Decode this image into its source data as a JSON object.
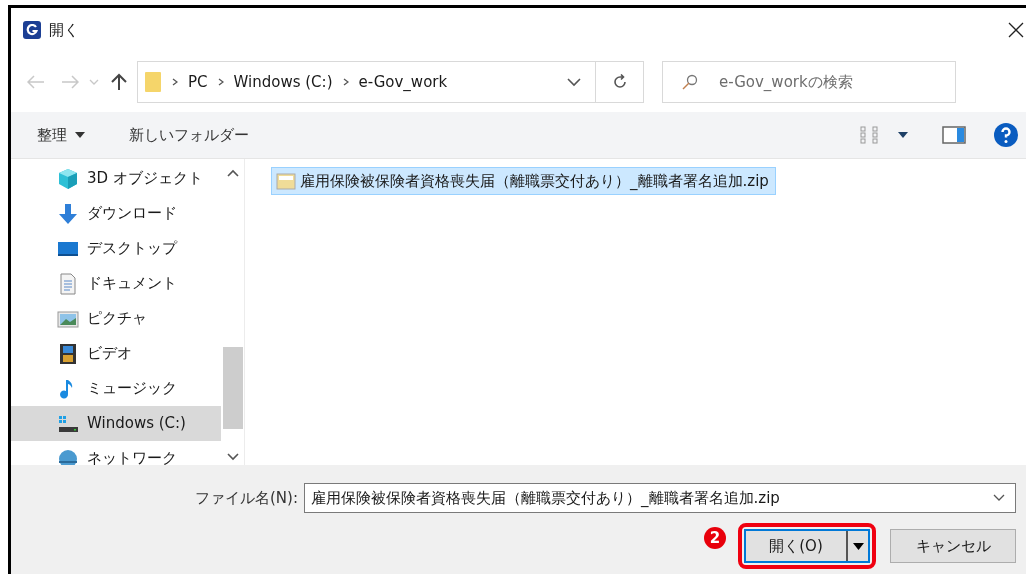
{
  "window": {
    "title": "開く"
  },
  "address": {
    "path": [
      "PC",
      "Windows (C:)",
      "e-Gov_work"
    ]
  },
  "search": {
    "placeholder": "e-Gov_workの検索"
  },
  "toolbar": {
    "organize": "整理",
    "new_folder": "新しいフォルダー"
  },
  "nav_items": [
    {
      "label": "3D オブジェクト",
      "kind": "cube",
      "selected": false
    },
    {
      "label": "ダウンロード",
      "kind": "download",
      "selected": false
    },
    {
      "label": "デスクトップ",
      "kind": "desktop",
      "selected": false
    },
    {
      "label": "ドキュメント",
      "kind": "document",
      "selected": false
    },
    {
      "label": "ピクチャ",
      "kind": "pictures",
      "selected": false
    },
    {
      "label": "ビデオ",
      "kind": "video",
      "selected": false
    },
    {
      "label": "ミュージック",
      "kind": "music",
      "selected": false
    },
    {
      "label": "Windows (C:)",
      "kind": "drive",
      "selected": true
    },
    {
      "label": "ネットワーク",
      "kind": "network",
      "selected": false
    }
  ],
  "files": [
    {
      "name": "雇用保険被保険者資格喪失届（離職票交付あり）_離職者署名追加.zip",
      "selected": true
    }
  ],
  "filename": {
    "label": "ファイル名(N):",
    "value": "雇用保険被保険者資格喪失届（離職票交付あり）_離職者署名追加.zip"
  },
  "buttons": {
    "open": "開く(O)",
    "cancel": "キャンセル"
  },
  "step_badge": "2"
}
